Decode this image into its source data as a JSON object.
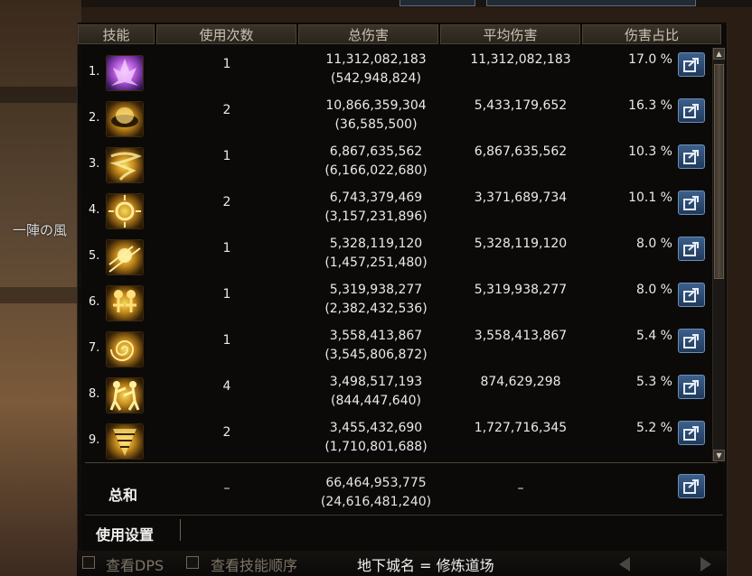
{
  "background": {
    "label": "一陣の風"
  },
  "table": {
    "headers": [
      "技能",
      "使用次数",
      "总伤害",
      "平均伤害",
      "伤害占比"
    ],
    "rows": [
      {
        "rank": "1.",
        "icon": "purple-fire-skill-icon",
        "uses": "1",
        "total": "11,312,082,183",
        "total_sub": "(542,948,824)",
        "avg": "11,312,082,183",
        "pct": "17.0 %"
      },
      {
        "rank": "2.",
        "icon": "golden-helmet-skill-icon",
        "uses": "2",
        "total": "10,866,359,304",
        "total_sub": "(36,585,500)",
        "avg": "5,433,179,652",
        "pct": "16.3 %"
      },
      {
        "rank": "3.",
        "icon": "tornado-skill-icon",
        "uses": "1",
        "total": "6,867,635,562",
        "total_sub": "(6,166,022,680)",
        "avg": "6,867,635,562",
        "pct": "10.3 %"
      },
      {
        "rank": "4.",
        "icon": "sun-burst-skill-icon",
        "uses": "2",
        "total": "6,743,379,469",
        "total_sub": "(3,157,231,896)",
        "avg": "3,371,689,734",
        "pct": "10.1 %"
      },
      {
        "rank": "5.",
        "icon": "light-rays-skill-icon",
        "uses": "1",
        "total": "5,328,119,120",
        "total_sub": "(1,457,251,480)",
        "avg": "5,328,119,120",
        "pct": "8.0 %"
      },
      {
        "rank": "6.",
        "icon": "twin-figures-skill-icon",
        "uses": "1",
        "total": "5,319,938,277",
        "total_sub": "(2,382,432,536)",
        "avg": "5,319,938,277",
        "pct": "8.0 %"
      },
      {
        "rank": "7.",
        "icon": "spiral-skill-icon",
        "uses": "1",
        "total": "3,558,413,867",
        "total_sub": "(3,545,806,872)",
        "avg": "3,558,413,867",
        "pct": "5.4 %"
      },
      {
        "rank": "8.",
        "icon": "fighters-skill-icon",
        "uses": "4",
        "total": "3,498,517,193",
        "total_sub": "(844,447,640)",
        "avg": "874,629,298",
        "pct": "5.3 %"
      },
      {
        "rank": "9.",
        "icon": "drill-skill-icon",
        "uses": "2",
        "total": "3,455,432,690",
        "total_sub": "(1,710,801,688)",
        "avg": "1,727,716,345",
        "pct": "5.2 %"
      }
    ]
  },
  "summary": {
    "label": "总和",
    "uses": "–",
    "total": "66,464,953,775",
    "total_sub": "(24,616,481,240)",
    "avg": "–"
  },
  "settings": {
    "label": "使用设置"
  },
  "bottom": {
    "view_dps": "查看DPS",
    "view_skill_order": "查看技能顺序",
    "dungeon": "地下城名 = 修炼道场"
  },
  "colors": {
    "panel_bg": "#0a0908",
    "header_bg": "#3b3328",
    "export_button": "#2f5383",
    "text": "#e6e6e6"
  }
}
